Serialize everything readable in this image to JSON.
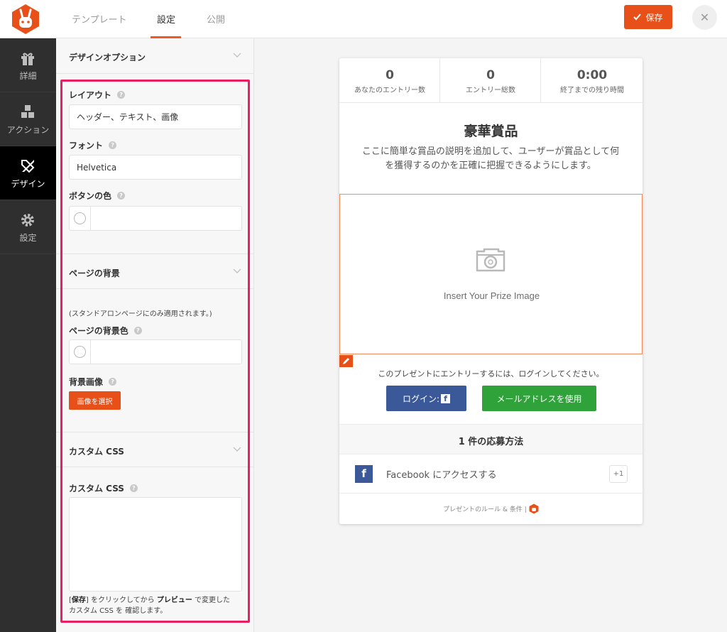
{
  "topbar": {
    "tabs": [
      {
        "label": "テンプレート"
      },
      {
        "label": "設定"
      },
      {
        "label": "公開"
      }
    ],
    "save_label": "保存",
    "close_label": "✕"
  },
  "leftnav": {
    "items": [
      {
        "label": "詳細",
        "icon": "gift-icon"
      },
      {
        "label": "アクション",
        "icon": "cubes-icon"
      },
      {
        "label": "デザイン",
        "icon": "design-tools-icon"
      },
      {
        "label": "設定",
        "icon": "gear-icon"
      }
    ],
    "active": "デザイン"
  },
  "panel": {
    "design_options_title": "デザインオプション",
    "layout_label": "レイアウト",
    "layout_value": "ヘッダー、テキスト、画像",
    "font_label": "フォント",
    "font_value": "Helvetica",
    "button_color_label": "ボタンの色",
    "page_bg_title": "ページの背景",
    "page_bg_note": "(スタンドアロンページにのみ適用されます。)",
    "page_bg_color_label": "ページの背景色",
    "bg_image_label": "背景画像",
    "select_image_label": "画像を選択",
    "custom_css_title": "カスタム CSS",
    "custom_css_label": "カスタム CSS",
    "help_bracket_open": "[",
    "help_save": "保存",
    "help_mid1": "] をクリックしてから ",
    "help_preview": "プレビュー",
    "help_mid2": " で変更した",
    "help_line2": "カスタム CSS を 確認します。",
    "help_icon": "?"
  },
  "preview": {
    "stats": [
      {
        "value": "0",
        "label": "あなたのエントリー数"
      },
      {
        "value": "0",
        "label": "エントリー総数"
      },
      {
        "value": "0:00",
        "label": "終了までの残り時間"
      }
    ],
    "prize_title": "豪華賞品",
    "prize_desc": "ここに簡単な賞品の説明を追加して、ユーザーが賞品として何を獲得するのかを正確に把握できるようにします。",
    "prize_image_text": "Insert Your Prize Image",
    "login_prompt": "このプレゼントにエントリーするには、ログインしてください。",
    "fb_login_label": "ログイン:",
    "fb_letter": "f",
    "email_button_label": "メールアドレスを使用",
    "methods_title": "1 件の応募方法",
    "method": {
      "label": "Facebook にアクセスする",
      "points": "+1"
    },
    "rules_text": "プレゼントのルール & 条件 |"
  },
  "colors": {
    "accent": "#e8501a",
    "highlight": "#ea1f63",
    "facebook": "#3b5998",
    "email_green": "#2fa33a",
    "nav_bg": "#2f2f2f"
  }
}
